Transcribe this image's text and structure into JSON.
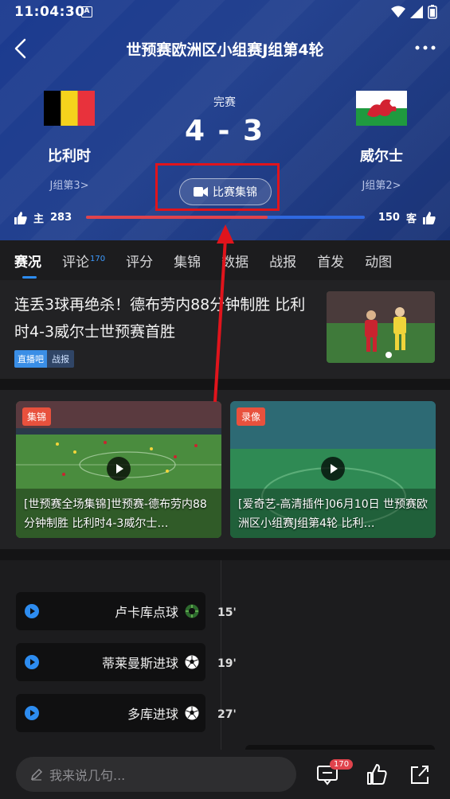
{
  "status_bar": {
    "time": "11:04:30",
    "notification_letter": "A"
  },
  "header": {
    "title": "世预赛欧洲区小组赛J组第4轮"
  },
  "match": {
    "status": "完赛",
    "score": "4 - 3",
    "home": {
      "name": "比利时",
      "group_rank": "J组第3>"
    },
    "away": {
      "name": "威尔士",
      "group_rank": "J组第2>"
    },
    "highlight_button": "比赛集锦",
    "home_likes": "283",
    "away_likes": "150",
    "away_label": "客",
    "support_ratio": 0.65
  },
  "tabs": [
    {
      "label": "赛况"
    },
    {
      "label": "评论",
      "count": "170"
    },
    {
      "label": "评分"
    },
    {
      "label": "集锦"
    },
    {
      "label": "数据"
    },
    {
      "label": "战报"
    },
    {
      "label": "首发"
    },
    {
      "label": "动图"
    }
  ],
  "news": {
    "title": "连丢3球再绝杀！德布劳内88分钟制胜 比利时4-3威尔士世预赛首胜",
    "tag_source": "直播吧",
    "tag_type": "战报"
  },
  "videos": [
    {
      "badge": "集锦",
      "title": "[世预赛全场集锦]世预赛-德布劳内88分钟制胜 比利时4-3威尔士…"
    },
    {
      "badge": "录像",
      "title": "[爱奇艺-高清插件]06月10日 世预赛欧洲区小组赛J组第4轮 比利…"
    }
  ],
  "events": [
    {
      "name": "卢卡库点球",
      "minute": "15'",
      "icon": "penalty-icon"
    },
    {
      "name": "蒂莱曼斯进球",
      "minute": "19'",
      "icon": "soccer-ball-icon"
    },
    {
      "name": "多库进球",
      "minute": "27'",
      "icon": "soccer-ball-icon"
    }
  ],
  "bottom": {
    "placeholder": "我来说几句...",
    "comment_count": "170"
  },
  "colors": {
    "accent": "#2d8cf0",
    "home_bar": "#e0434c",
    "away_bar": "#2f68e0",
    "annotation": "#e0141c"
  }
}
